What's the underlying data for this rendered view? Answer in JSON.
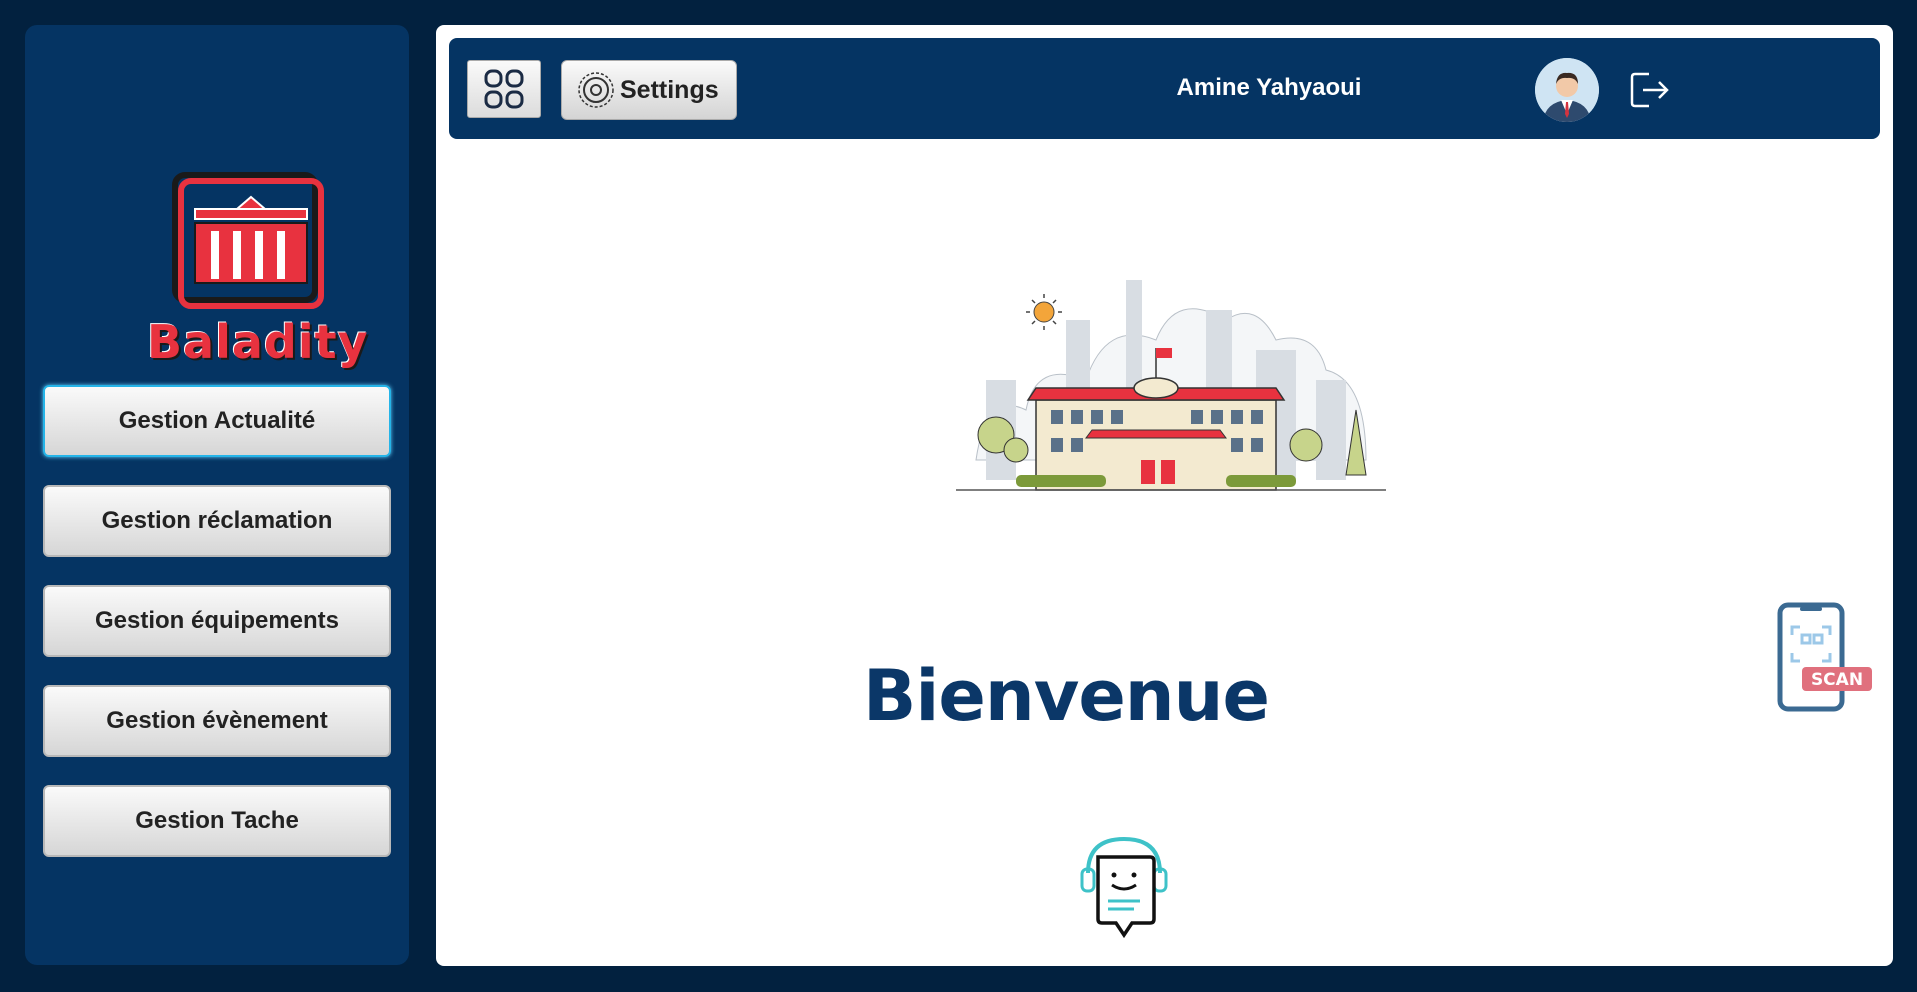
{
  "app": {
    "logo_text": "Baladity"
  },
  "sidebar": {
    "items": [
      {
        "label": "Gestion Actualité",
        "active": true
      },
      {
        "label": "Gestion réclamation",
        "active": false
      },
      {
        "label": "Gestion équipements",
        "active": false
      },
      {
        "label": "Gestion évènement",
        "active": false
      },
      {
        "label": "Gestion Tache",
        "active": false
      }
    ]
  },
  "topbar": {
    "menu_icon": "grid-icon",
    "settings_label": "Settings",
    "settings_icon": "gear-icon",
    "user_name": "Amine Yahyaoui",
    "avatar_icon": "user-avatar",
    "logout_icon": "logout-icon"
  },
  "main": {
    "hero_image": "city-hall-illustration",
    "welcome_text": "Bienvenue",
    "scan_label": "SCAN",
    "scan_icon": "qr-scan-phone-icon",
    "chatbot_icon": "chatbot-icon"
  },
  "colors": {
    "background": "#02213f",
    "panel": "#053463",
    "accent_red": "#e8323f",
    "welcome_text": "#0b3768",
    "active_border": "#25b4e8"
  }
}
